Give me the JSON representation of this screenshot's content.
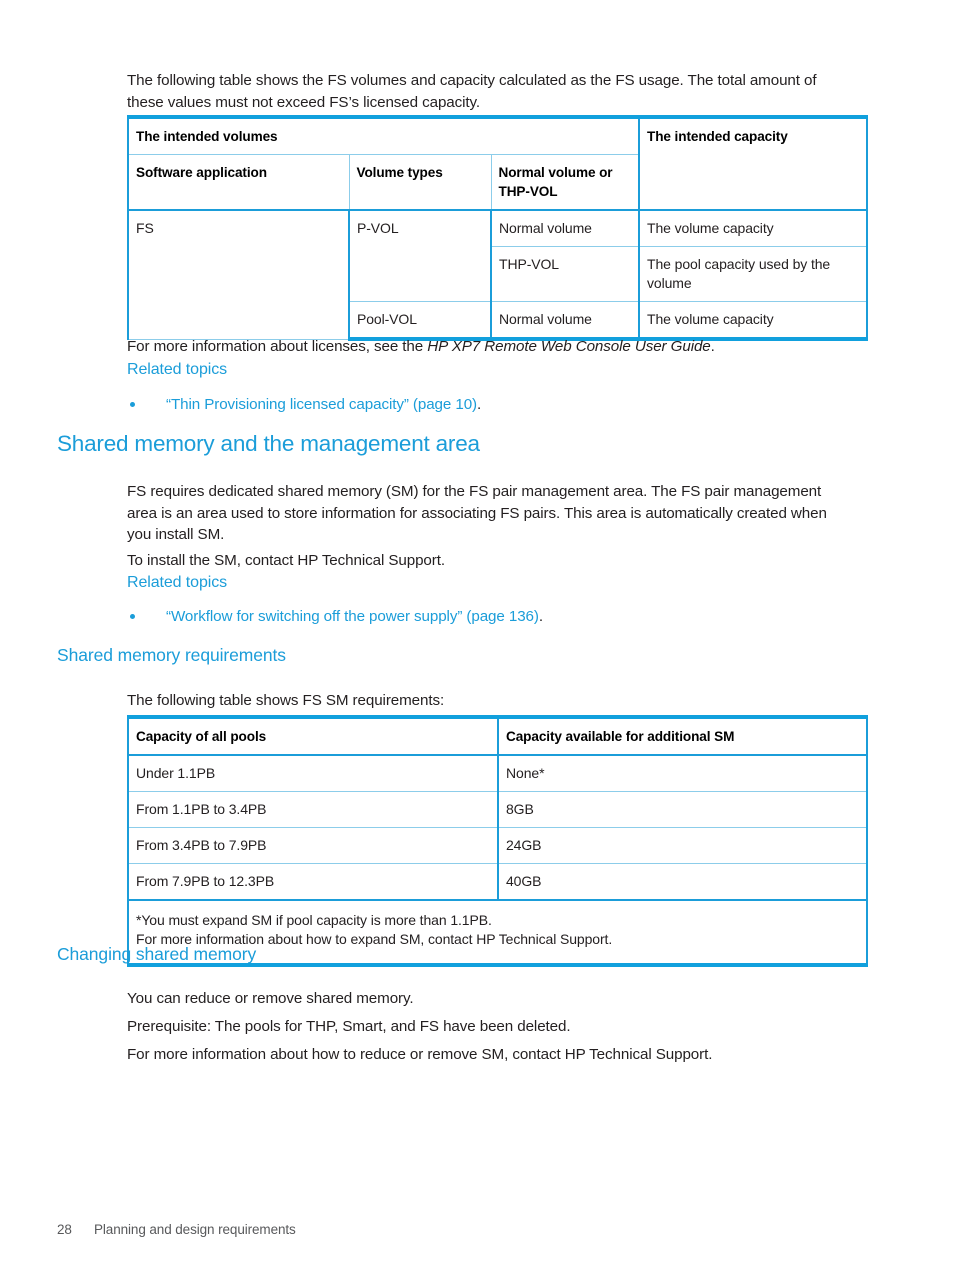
{
  "intro": {
    "paragraph": "The following table shows the FS volumes and capacity calculated as the FS usage. The total amount of these values must not exceed FS’s licensed capacity."
  },
  "volumes_table": {
    "group_headers": {
      "volumes": "The intended volumes",
      "capacity": "The intended capacity"
    },
    "columns": [
      "Software application",
      "Volume types",
      "Normal volume or THP-VOL"
    ],
    "column_normal_volume_line1": "Normal volume or",
    "column_normal_volume_line2": "THP-VOL",
    "rows": [
      {
        "software_application": "FS",
        "volume_type": "P-VOL",
        "normal_or_thp": "Normal volume",
        "intended_capacity": "The volume capacity"
      },
      {
        "software_application": "",
        "volume_type": "",
        "normal_or_thp": "THP-VOL",
        "intended_capacity": "The pool capacity used by the volume"
      },
      {
        "software_application": "",
        "volume_type": "Pool-VOL",
        "normal_or_thp": "Normal volume",
        "intended_capacity": "The volume capacity"
      }
    ]
  },
  "licenses_note": {
    "lead": "For more information about licenses, see the ",
    "italic_title": "HP XP7 Remote Web Console User Guide",
    "tail": "."
  },
  "related_topics_1": {
    "heading": "Related topics",
    "link_text": "“Thin Provisioning licensed capacity” (page 10)",
    "link_tail": "."
  },
  "shared_memory_section": {
    "heading": "Shared memory and the management area",
    "paragraph_1": "FS requires dedicated shared memory (SM) for the FS pair management area. The FS pair management area is an area used to store information for associating FS pairs. This area is automatically created when you install SM.",
    "paragraph_2": "To install the SM, contact HP Technical Support."
  },
  "related_topics_2": {
    "heading": "Related topics",
    "link_text": "“Workflow for switching off the power supply” (page 136)",
    "link_tail": "."
  },
  "shared_memory_requirements": {
    "heading": "Shared memory requirements",
    "intro": "The following table shows FS SM requirements:"
  },
  "sm_table": {
    "columns": [
      "Capacity of all pools",
      "Capacity available for additional SM"
    ],
    "rows": [
      {
        "pool_capacity": "Under 1.1PB",
        "additional_sm": "None*"
      },
      {
        "pool_capacity": "From 1.1PB to 3.4PB",
        "additional_sm": "8GB"
      },
      {
        "pool_capacity": "From 3.4PB to 7.9PB",
        "additional_sm": "24GB"
      },
      {
        "pool_capacity": "From 7.9PB to 12.3PB",
        "additional_sm": "40GB"
      }
    ],
    "footnote_line_1": "*You must expand SM if pool capacity is more than 1.1PB.",
    "footnote_line_2": "For more information about how to expand SM, contact HP Technical Support."
  },
  "changing_shared_memory": {
    "heading": "Changing shared memory",
    "paragraph_1": "You can reduce or remove shared memory.",
    "paragraph_2": "Prerequisite: The pools for THP, Smart, and FS have been deleted.",
    "paragraph_3": "For more information about how to reduce or remove SM, contact HP Technical Support."
  },
  "footer": {
    "page_number": "28",
    "chapter": "Planning and design requirements"
  },
  "colors": {
    "heading_blue": "#1b9dd9",
    "table_rule": "#11a0dd",
    "table_grid": "#8ccdea",
    "body_text": "#231f20",
    "footer_text": "#58595b"
  }
}
